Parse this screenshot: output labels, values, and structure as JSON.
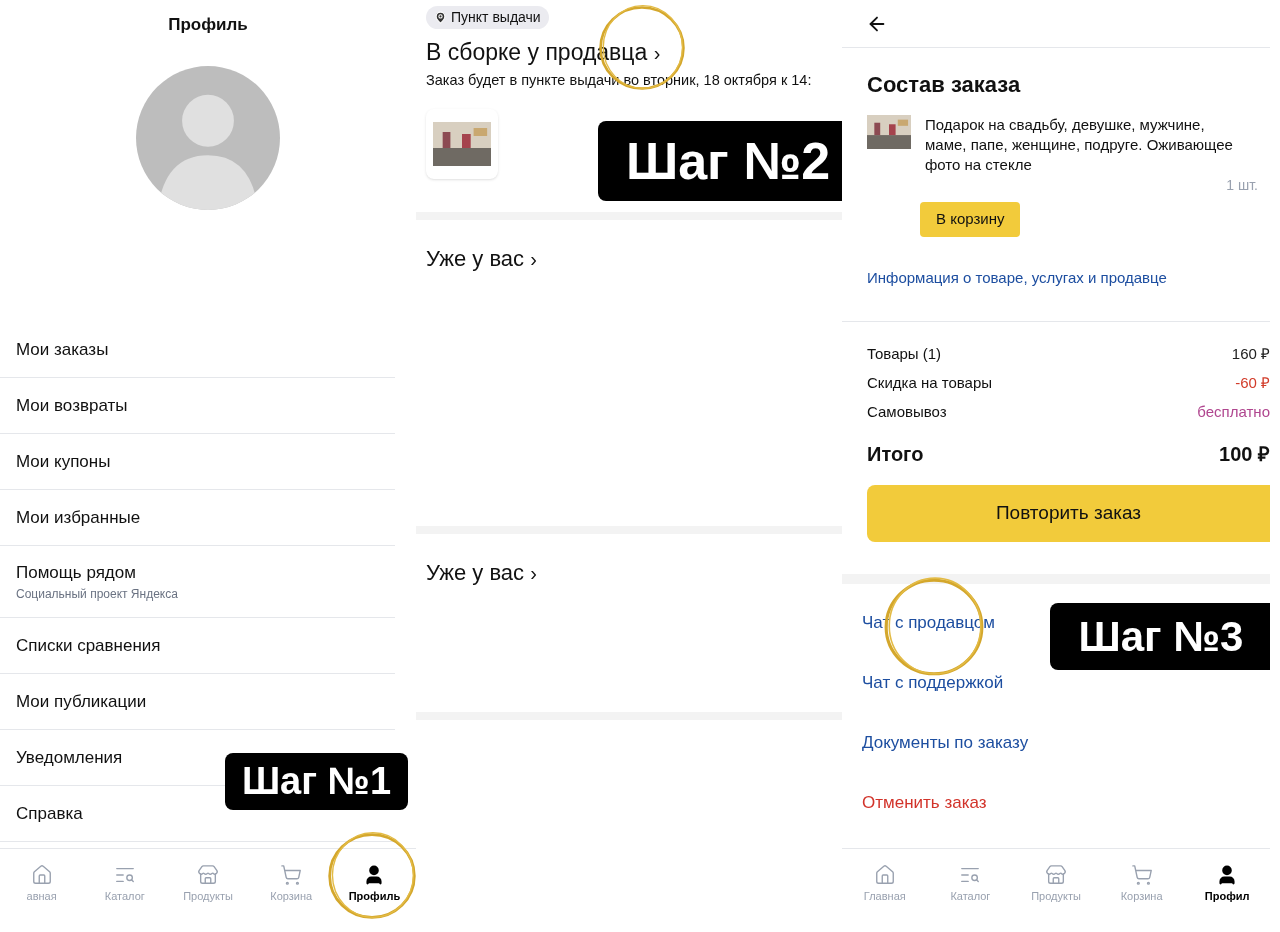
{
  "profile": {
    "title": "Профиль",
    "menu": [
      {
        "label": "Мои заказы"
      },
      {
        "label": "Мои возвраты"
      },
      {
        "label": "Мои купоны"
      },
      {
        "label": "Мои избранные"
      },
      {
        "label": "Помощь рядом",
        "subtitle": "Социальный проект Яндекса"
      },
      {
        "label": "Списки сравнения"
      },
      {
        "label": "Мои публикации"
      },
      {
        "label": "Уведомления"
      },
      {
        "label": "Справка"
      }
    ],
    "step_label": "Шаг №1",
    "nav": [
      {
        "label": "авная",
        "selected": false
      },
      {
        "label": "Каталог",
        "selected": false
      },
      {
        "label": "Продукты",
        "selected": false
      },
      {
        "label": "Корзина",
        "selected": false
      },
      {
        "label": "Профиль",
        "selected": true
      }
    ]
  },
  "order": {
    "chip": "Пункт выдачи",
    "status": "В сборке у продавца",
    "arrow": "›",
    "note": "Заказ будет в пункте выдачи во вторник, 18 октября к 14:",
    "step_label": "Шаг №2",
    "sections": [
      {
        "title": "Уже у вас",
        "arrow": "›"
      },
      {
        "title": "Уже у вас",
        "arrow": "›"
      }
    ]
  },
  "details": {
    "title": "Состав заказа",
    "item": "Подарок на свадьбу, девушке, мужчине, маме, папе, женщине, подруге. Оживающее фото на стекле",
    "qty": "1 шт.",
    "cart_button": "В корзину",
    "info_link": "Информация о товаре, услугах и продавце",
    "summary": [
      {
        "label": "Товары (1)",
        "value": "160 ₽",
        "kind": "plain"
      },
      {
        "label": "Скидка на товары",
        "value": "-60 ₽",
        "kind": "discount"
      },
      {
        "label": "Самовывоз",
        "value": "бесплатно",
        "kind": "free"
      }
    ],
    "total_label": "Итого",
    "total_value": "100 ₽",
    "repeat_button": "Повторить заказ",
    "links": [
      {
        "label": "Чат с продавцом",
        "kind": "link"
      },
      {
        "label": "Чат с поддержкой",
        "kind": "link"
      },
      {
        "label": "Документы по заказу",
        "kind": "link"
      },
      {
        "label": "Отменить заказ",
        "kind": "danger"
      }
    ],
    "step_label": "Шаг №3",
    "nav": [
      {
        "label": "Главная",
        "selected": false
      },
      {
        "label": "Каталог",
        "selected": false
      },
      {
        "label": "Продукты",
        "selected": false
      },
      {
        "label": "Корзина",
        "selected": false
      },
      {
        "label": "Профил",
        "selected": true
      }
    ]
  }
}
